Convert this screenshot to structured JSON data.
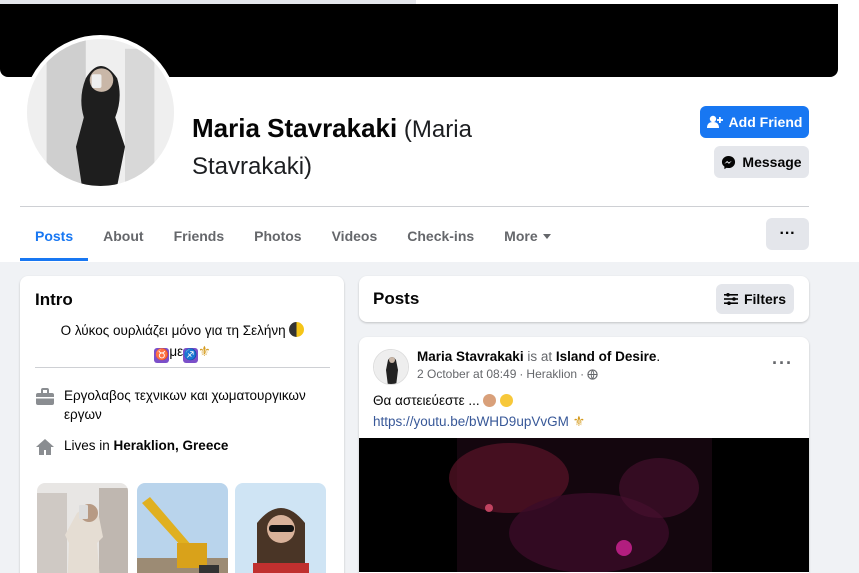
{
  "profile": {
    "name": "Maria Stavrakaki",
    "alt_name": "(Maria Stavrakaki)"
  },
  "actions": {
    "add_friend": "Add Friend",
    "message": "Message",
    "more_dots": "···"
  },
  "tabs": [
    {
      "label": "Posts",
      "active": true
    },
    {
      "label": "About"
    },
    {
      "label": "Friends"
    },
    {
      "label": "Photos"
    },
    {
      "label": "Videos"
    },
    {
      "label": "Check-ins"
    },
    {
      "label": "More"
    }
  ],
  "intro": {
    "title": "Intro",
    "bio_line1": "Ο λύκος ουρλιάζει μόνο για τη Σελήνη",
    "bio_line2_mid": "με",
    "work": "Εργολαβος τεχνικων και χωματουργικων εργων",
    "lives_prefix": "Lives in ",
    "lives_place": "Heraklion, Greece"
  },
  "posts": {
    "title": "Posts",
    "filters_label": "Filters"
  },
  "post": {
    "author": "Maria Stavrakaki",
    "is_at": " is at ",
    "place": "Island of Desire",
    "period": ".",
    "date": "2 October at 08:49",
    "separator": "·",
    "location": "Heraklion",
    "text": "Θα αστειεύεστε ...",
    "link": "https://youtu.be/bWHD9upVvGM",
    "options": "···"
  },
  "colors": {
    "accent": "#1877f2",
    "link": "#385898",
    "muted": "#65676b"
  }
}
